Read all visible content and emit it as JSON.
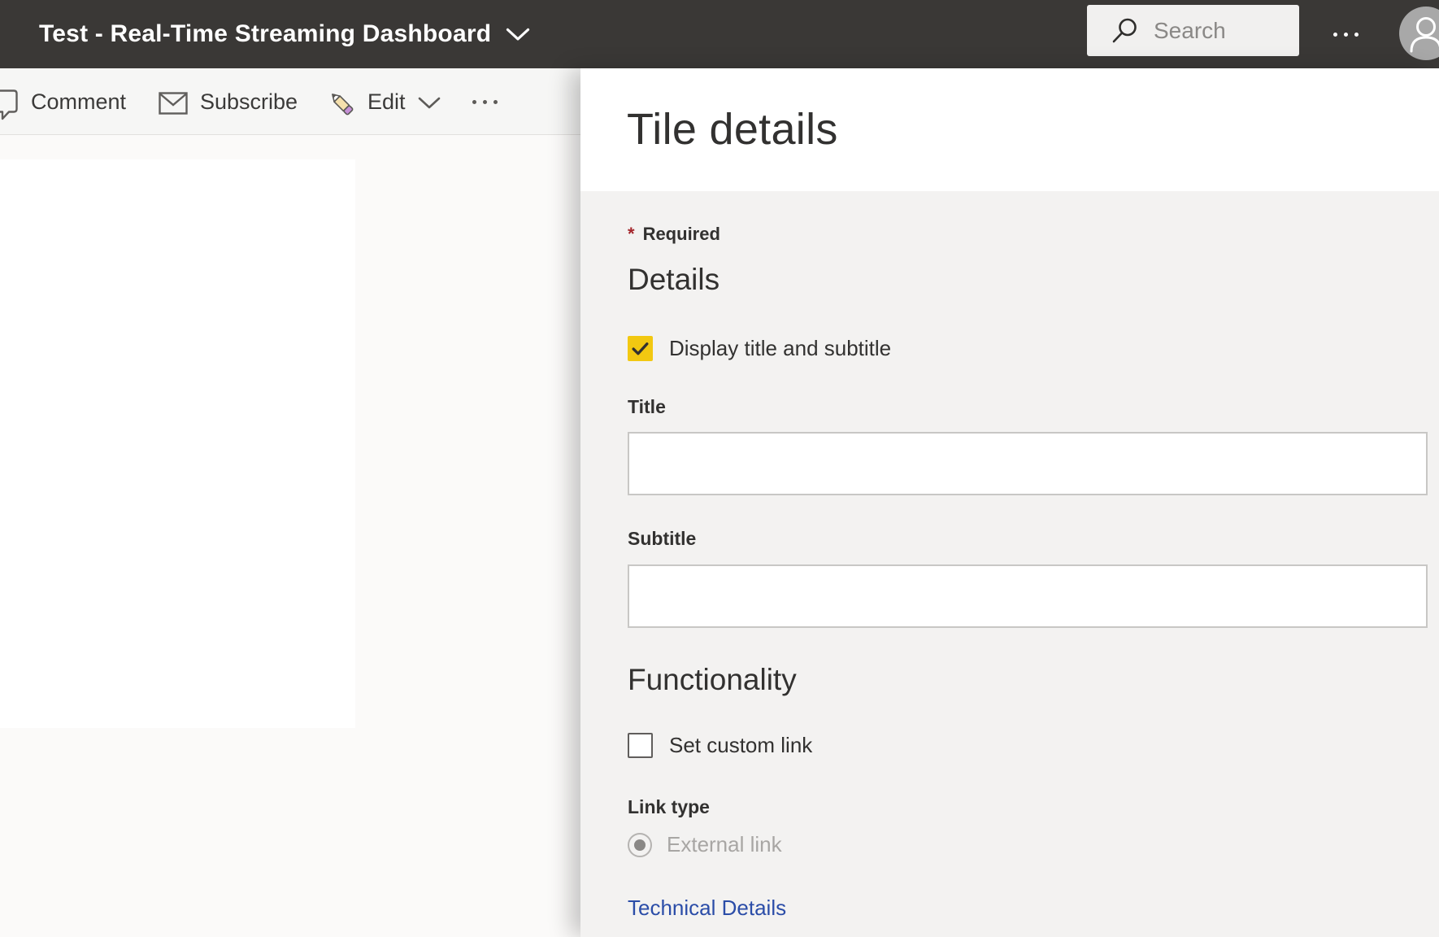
{
  "top_bar": {
    "dashboard_title": "Test - Real-Time Streaming Dashboard",
    "search": {
      "placeholder": "Search"
    }
  },
  "toolbar": {
    "comment": "Comment",
    "subscribe": "Subscribe",
    "edit": "Edit"
  },
  "panel": {
    "title": "Tile details",
    "required": {
      "asterisk": "*",
      "label": "Required"
    },
    "details": {
      "heading": "Details",
      "display_title_checkbox": {
        "label": "Display title and subtitle",
        "checked": true
      },
      "title_field": {
        "label": "Title",
        "value": ""
      },
      "subtitle_field": {
        "label": "Subtitle",
        "value": ""
      }
    },
    "functionality": {
      "heading": "Functionality",
      "set_custom_link_checkbox": {
        "label": "Set custom link",
        "checked": false
      },
      "link_type": {
        "label": "Link type",
        "options": [
          {
            "label": "External link",
            "selected": true,
            "disabled": true
          }
        ]
      },
      "technical_details_link": "Technical Details"
    }
  },
  "colors": {
    "topbar_bg": "#3a3836",
    "accent_yellow": "#f2c811",
    "required_red": "#a4262c",
    "link_blue": "#2b4da8",
    "panel_body_bg": "#f3f2f1"
  }
}
